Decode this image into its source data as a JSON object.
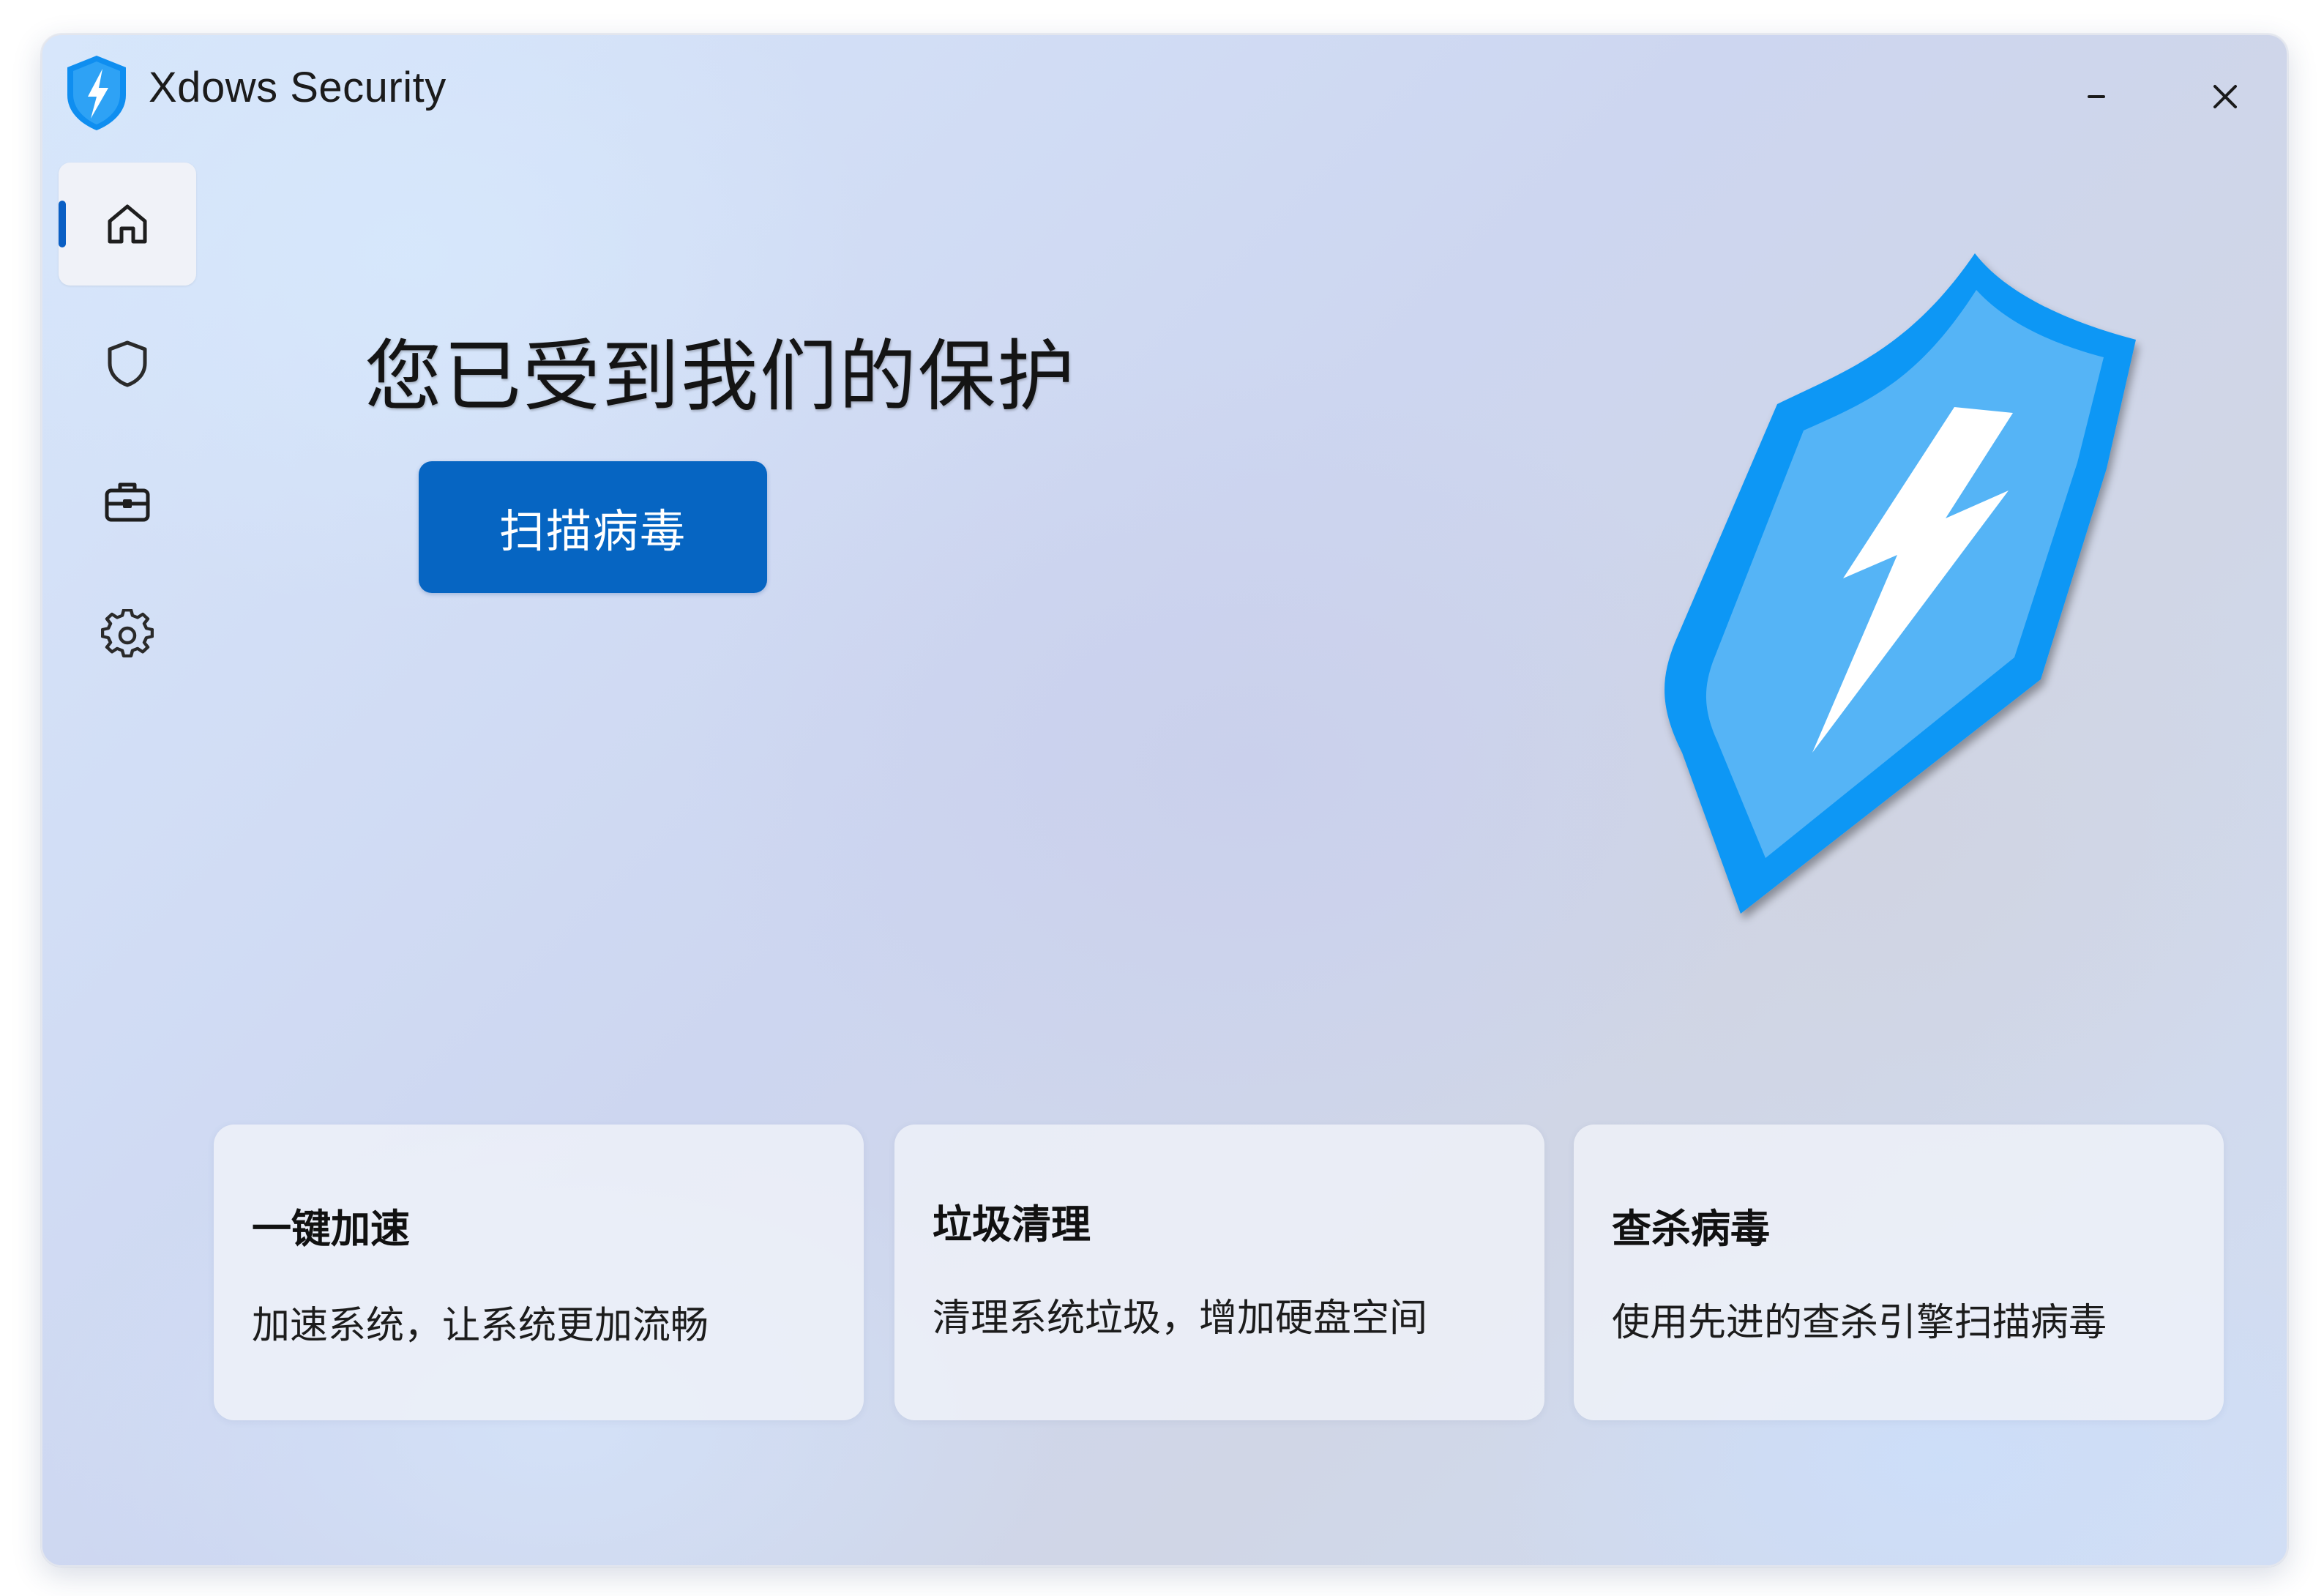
{
  "window": {
    "title": "Xdows Security"
  },
  "titlebar": {
    "minimize_glyph": "–",
    "close_glyph": "✕"
  },
  "sidebar": {
    "items": [
      {
        "id": "home",
        "icon": "home-icon",
        "active": true
      },
      {
        "id": "protection",
        "icon": "shield-icon",
        "active": false
      },
      {
        "id": "toolbox",
        "icon": "toolbox-icon",
        "active": false
      },
      {
        "id": "settings",
        "icon": "gear-icon",
        "active": false
      }
    ]
  },
  "hero": {
    "title": "您已受到我们的保护",
    "scan_button_label": "扫描病毒",
    "illustration": "shield-lightning-icon"
  },
  "cards": [
    {
      "title": "一键加速",
      "description": "加速系统，让系统更加流畅"
    },
    {
      "title": "垃圾清理",
      "description": "清理系统垃圾，增加硬盘空间"
    },
    {
      "title": "查杀病毒",
      "description": "使用先进的查杀引擎扫描病毒"
    }
  ],
  "colors": {
    "accent": "#0665c2",
    "shield_outer": "#0f97f5",
    "shield_inner": "#55b4f6",
    "indicator": "#0a5fc4"
  }
}
